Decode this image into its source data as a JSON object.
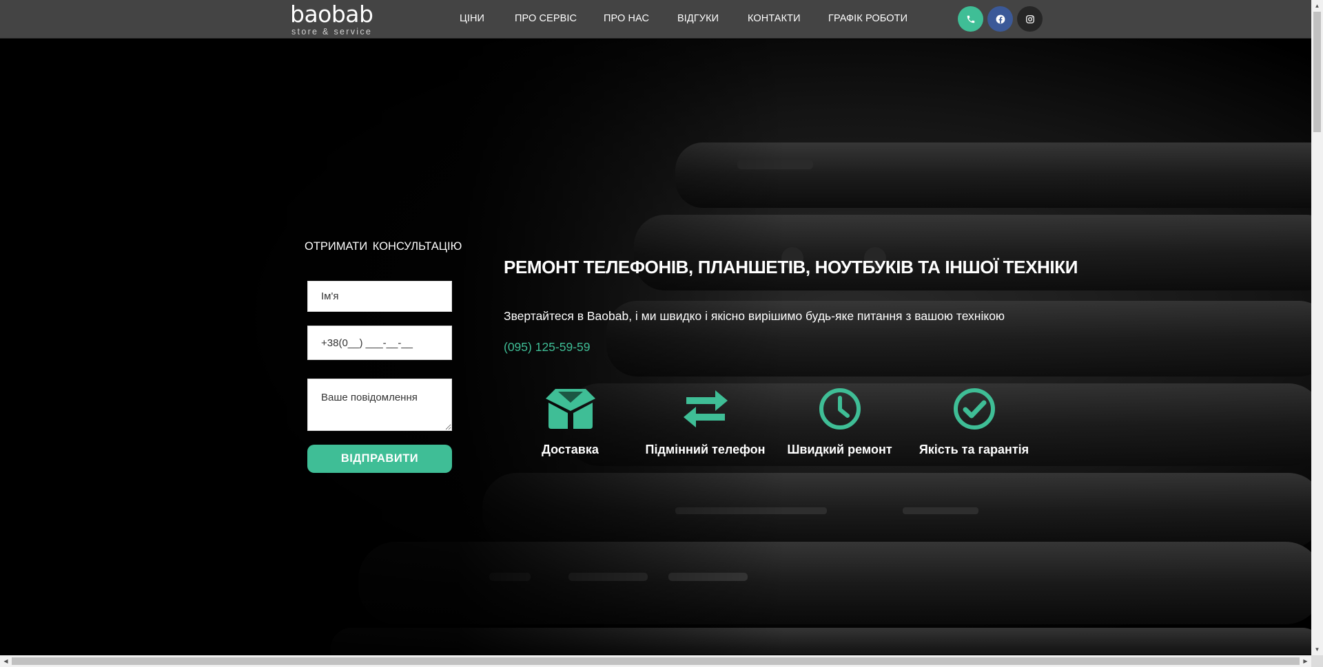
{
  "brand": {
    "logo_main": "baobab",
    "logo_sub": "store & service"
  },
  "nav": {
    "items": [
      "ЦІНИ",
      "ПРО СЕРВІС",
      "ПРО НАС",
      "ВІДГУКИ",
      "КОНТАКТИ",
      "ГРАФІК РОБОТИ"
    ]
  },
  "social": [
    {
      "icon": "phone-icon",
      "color": "#3fbe96"
    },
    {
      "icon": "facebook-icon",
      "color": "#3b5998"
    },
    {
      "icon": "instagram-icon",
      "color": "#262626"
    }
  ],
  "form": {
    "title": "ОТРИМАТИ КОНСУЛЬТАЦІЮ",
    "name_placeholder": "Ім'я",
    "phone_placeholder": "+38(0__) ___-__-__",
    "message_placeholder": "Ваше повідомлення",
    "submit_label": "ВІДПРАВИТИ"
  },
  "hero": {
    "title": "РЕМОНТ ТЕЛЕФОНІВ, ПЛАНШЕТІВ, НОУТБУКІВ ТА ІНШОЇ ТЕХНІКИ",
    "subtitle": "Звертайтеся в Baobab, і ми швидко і якісно вирішимо будь-яке питання з вашою технікою",
    "phone": "(095) 125-59-59"
  },
  "features": [
    {
      "icon": "box-icon",
      "label": "Доставка"
    },
    {
      "icon": "swap-arrows-icon",
      "label": "Підмінний телефон"
    },
    {
      "icon": "clock-icon",
      "label": "Швидкий ремонт"
    },
    {
      "icon": "check-circle-icon",
      "label": "Якість та гарантія"
    }
  ],
  "colors": {
    "accent": "#3fbe96",
    "header_bg": "#444444",
    "page_bg": "#000000"
  }
}
